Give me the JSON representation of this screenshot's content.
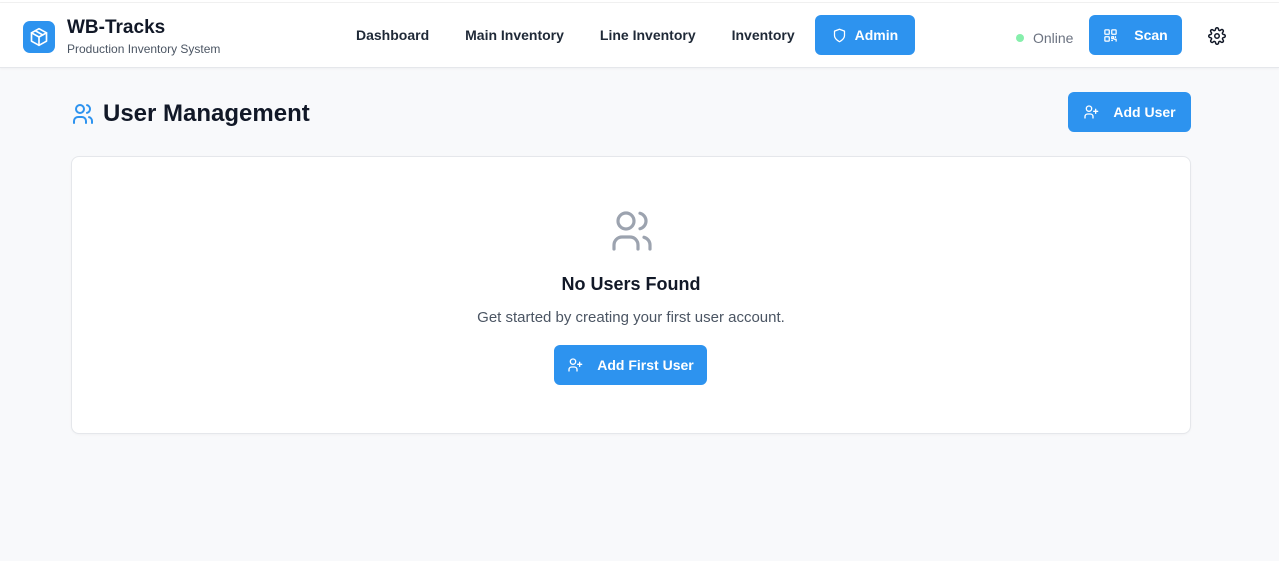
{
  "app": {
    "title": "WB-Tracks",
    "subtitle": "Production Inventory System",
    "logo_icon": "package-icon"
  },
  "nav": {
    "items": [
      {
        "label": "Dashboard"
      },
      {
        "label": "Main Inventory"
      },
      {
        "label": "Line Inventory"
      },
      {
        "label": "Inventory"
      },
      {
        "label": "Admin",
        "icon": "shield-icon",
        "active": true
      }
    ]
  },
  "status": {
    "label": "Online",
    "color": "#86efac"
  },
  "scan_button": {
    "label": "Scan",
    "icon": "qr-code-icon"
  },
  "settings_icon": "gear-icon",
  "page": {
    "title": "User Management",
    "title_icon": "users-icon",
    "add_button_label": "Add User",
    "add_button_icon": "user-plus-icon"
  },
  "empty_state": {
    "icon": "users-icon",
    "title": "No Users Found",
    "message": "Get started by creating your first user account.",
    "button_label": "Add First User",
    "button_icon": "user-plus-icon"
  },
  "colors": {
    "accent": "#2d93ef",
    "background": "#f8f9fb",
    "card": "#ffffff",
    "text": "#111827",
    "muted": "#4b5563"
  }
}
